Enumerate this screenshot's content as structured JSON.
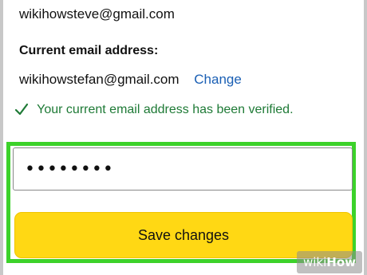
{
  "account": {
    "previous_email": "wikihowsteve@gmail.com",
    "current_label": "Current email address:",
    "current_email": "wikihowstefan@gmail.com",
    "change_label": "Change",
    "verified_text": "Your current email address has been verified.",
    "verified_color": "#1e7a36",
    "link_color": "#1a5fb4"
  },
  "form": {
    "password_value": "••••••••",
    "save_label": "Save changes",
    "button_color": "#ffd814",
    "highlight_color": "#3cd22a"
  },
  "watermark": {
    "wiki": "wiki",
    "how": "How"
  },
  "icons": {
    "check": "check-icon"
  }
}
